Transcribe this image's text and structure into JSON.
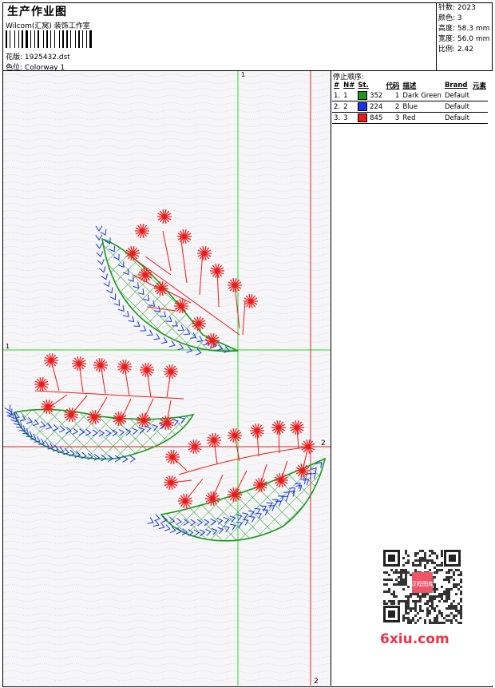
{
  "header": {
    "title": "生产作业图",
    "studio": "Wilcom(汇窝) 装饰工作室",
    "file_label": "花版:",
    "file_name": "1925432.dst",
    "colorway_label": "色位:",
    "colorway_name": "Colorway 1"
  },
  "stats": [
    {
      "label": "针数:",
      "value": "2023"
    },
    {
      "label": "颜色:",
      "value": "3"
    },
    {
      "label": "高度:",
      "value": "58.3 mm"
    },
    {
      "label": "宽度:",
      "value": "56.0 mm"
    },
    {
      "label": "比例:",
      "value": "2.42"
    }
  ],
  "stop_panel": {
    "title": "停止顺序:",
    "columns": [
      "#",
      "N#",
      "St.",
      "代码",
      "描述",
      "Brand",
      "元素"
    ],
    "rows": [
      {
        "num": "1.",
        "n": "1",
        "color": "#1a9a1a",
        "stitches": "352",
        "code": "1",
        "desc": "Dark Green",
        "brand": "Default"
      },
      {
        "num": "2.",
        "n": "2",
        "color": "#1a33ee",
        "stitches": "224",
        "code": "2",
        "desc": "Blue",
        "brand": "Default"
      },
      {
        "num": "3.",
        "n": "3",
        "color": "#ee1a1a",
        "stitches": "845",
        "code": "3",
        "desc": "Red",
        "brand": "Default"
      }
    ]
  },
  "guides": {
    "green_v_label": "1",
    "green_h_label": "1",
    "red_h_label": "2",
    "red_v_label": "2"
  },
  "watermark": {
    "text": "6xiu.com",
    "stamp": "汉程图库"
  },
  "colors": {
    "green": "#1a9a1a",
    "blue": "#1a33ee",
    "red": "#ee1a1a",
    "guide_green": "#22dd22",
    "guide_red": "#dd2222"
  }
}
